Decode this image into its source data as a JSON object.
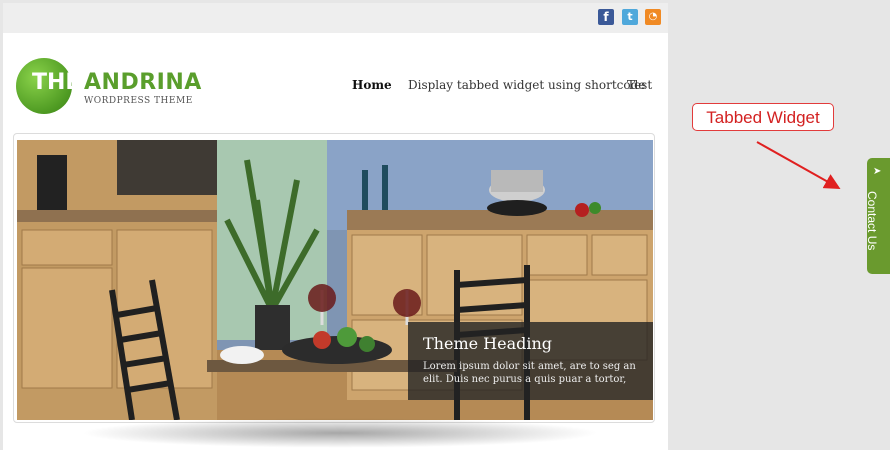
{
  "header": {
    "social": [
      {
        "name": "facebook-icon",
        "glyph": "f"
      },
      {
        "name": "twitter-icon",
        "glyph": "t"
      },
      {
        "name": "rss-icon",
        "glyph": "◔"
      }
    ]
  },
  "logo": {
    "the": "THE",
    "name": "ANDRINA",
    "subtitle": "WORDPRESS THEME",
    "color": "#5a9e2c"
  },
  "nav": {
    "items": [
      {
        "label": "Home",
        "active": true
      },
      {
        "label": "Display tabbed widget using shortcode",
        "active": false
      },
      {
        "label": "Test",
        "active": false
      }
    ]
  },
  "slider": {
    "caption_title": "Theme Heading",
    "caption_text": "Lorem ipsum dolor sit amet, are to seg an elit. Duis nec purus a quis puar a tortor,"
  },
  "annotation": {
    "label": "Tabbed Widget",
    "color": "#d32121"
  },
  "contact_tab": {
    "label": "Contact Us",
    "icon": "paper-plane-icon",
    "color": "#6a9a2e"
  }
}
